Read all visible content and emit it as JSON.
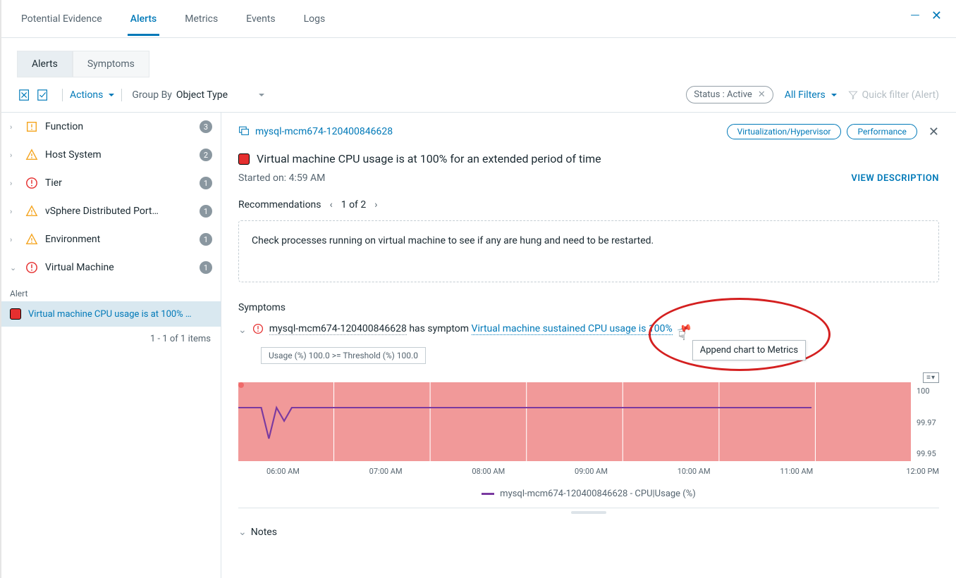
{
  "topTabs": {
    "t0": "Potential Evidence",
    "t1": "Alerts",
    "t2": "Metrics",
    "t3": "Events",
    "t4": "Logs"
  },
  "subTabs": {
    "alerts": "Alerts",
    "symptoms": "Symptoms"
  },
  "toolbar": {
    "actions": "Actions",
    "groupBy": "Group By",
    "groupByValue": "Object Type",
    "statusChip": "Status : Active",
    "allFilters": "All Filters",
    "quickFilter": "Quick filter (Alert)"
  },
  "sidebar": {
    "items": [
      {
        "label": "Function",
        "count": "3",
        "icon": "warn-o",
        "chev": "›"
      },
      {
        "label": "Host System",
        "count": "2",
        "icon": "warn-y",
        "chev": "›"
      },
      {
        "label": "Tier",
        "count": "1",
        "icon": "err",
        "chev": "›"
      },
      {
        "label": "vSphere Distributed Port…",
        "count": "1",
        "icon": "warn-y",
        "chev": "›"
      },
      {
        "label": "Environment",
        "count": "1",
        "icon": "warn-y",
        "chev": "›"
      },
      {
        "label": "Virtual Machine",
        "count": "1",
        "icon": "err",
        "chev": "⌄"
      }
    ],
    "alertHeader": "Alert",
    "alertRow": "Virtual machine CPU usage is at 100% …",
    "pager": "1 - 1 of 1 items"
  },
  "detail": {
    "objectName": "mysql-mcm674-120400846628",
    "tag1": "Virtualization/Hypervisor",
    "tag2": "Performance",
    "alertTitle": "Virtual machine CPU usage is at 100% for an extended period of time",
    "startedLabel": "Started on:",
    "startedVal": "4:59 AM",
    "viewDesc": "VIEW DESCRIPTION",
    "recoLabel": "Recommendations",
    "recoPage": "1 of 2",
    "recoText": "Check processes running on virtual machine to see if any are hung and need to be restarted.",
    "symptomsTitle": "Symptoms",
    "symptomPrefix": "mysql-mcm674-120400846628",
    "symptomMid": " has symptom ",
    "symptomLink": "Virtual machine sustained CPU usage is 100%",
    "tooltip": "Append chart to Metrics",
    "threshold": "Usage (%) 100.0 >= Threshold (%) 100.0",
    "notes": "Notes"
  },
  "chart_data": {
    "type": "line",
    "title": "",
    "xlabel": "",
    "ylabel": "",
    "ylim": [
      99.95,
      100
    ],
    "y_ticks": [
      "100",
      "99.97",
      "99.95"
    ],
    "categories": [
      "06:00 AM",
      "07:00 AM",
      "08:00 AM",
      "09:00 AM",
      "10:00 AM",
      "11:00 AM",
      "12:00 PM"
    ],
    "series": [
      {
        "name": "mysql-mcm674-120400846628 - CPU|Usage (%)",
        "values": [
          100,
          99.95,
          100,
          99.97,
          100,
          100,
          100,
          100,
          100,
          100,
          100,
          100,
          100
        ]
      }
    ],
    "legend": "mysql-mcm674-120400846628 - CPU|Usage (%)"
  }
}
